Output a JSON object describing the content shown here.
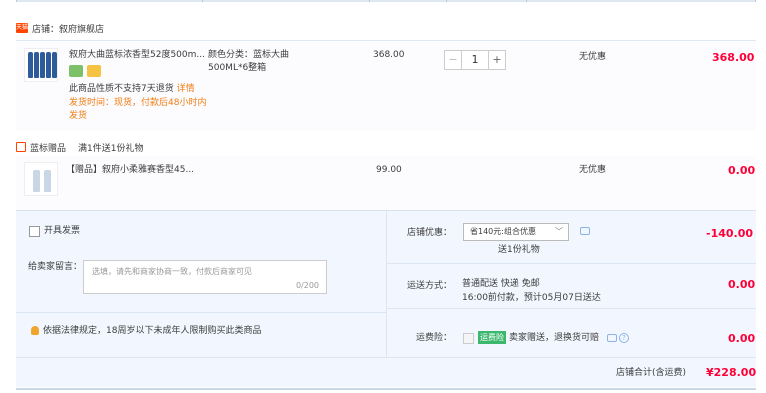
{
  "shop": {
    "badge": "天猫",
    "name": "店铺：叙府旗舰店"
  },
  "item": {
    "title": "叙府大曲蓝标浓香型52度500m...",
    "sku_label": "颜色分类：蓝标大曲500ML*6整箱",
    "notice": "此商品性质不支持7天退货",
    "notice_link": "详情",
    "ship_text": "发货时间：现货，付款后48小时内发货",
    "price": "368.00",
    "quantity": "1",
    "minus": "−",
    "plus": "+",
    "promo": "无优惠",
    "subtotal": "368.00"
  },
  "gift": {
    "section_title": "蓝标赠品",
    "rule": "满1件送1份礼物",
    "title": "【赠品】叙府小柔雅赛香型45...",
    "price": "99.00",
    "promo": "无优惠",
    "subtotal": "0.00"
  },
  "invoice": {
    "label": "开具发票"
  },
  "message": {
    "label": "给卖家留言：",
    "placeholder": "选填，请先和商家协商一致，付款后商家可见",
    "count": "0/200"
  },
  "legal": {
    "text": "依据法律规定，18周岁以下未成年人限制购买此类商品"
  },
  "discount": {
    "label": "店铺优惠：",
    "selected": "省140元:组合优惠",
    "sub": "送1份礼物",
    "amount": "-140.00"
  },
  "delivery": {
    "label": "运送方式：",
    "method": "普通配送 快递 免邮",
    "eta": "16:00前付款，预计05月07日送达",
    "amount": "0.00"
  },
  "insurance": {
    "label": "运费险：",
    "tag": "运费险",
    "text": "卖家赠送，退换货可赔",
    "amount": "0.00"
  },
  "total": {
    "label": "店铺合计(含运费)",
    "amount": "¥228.00"
  }
}
